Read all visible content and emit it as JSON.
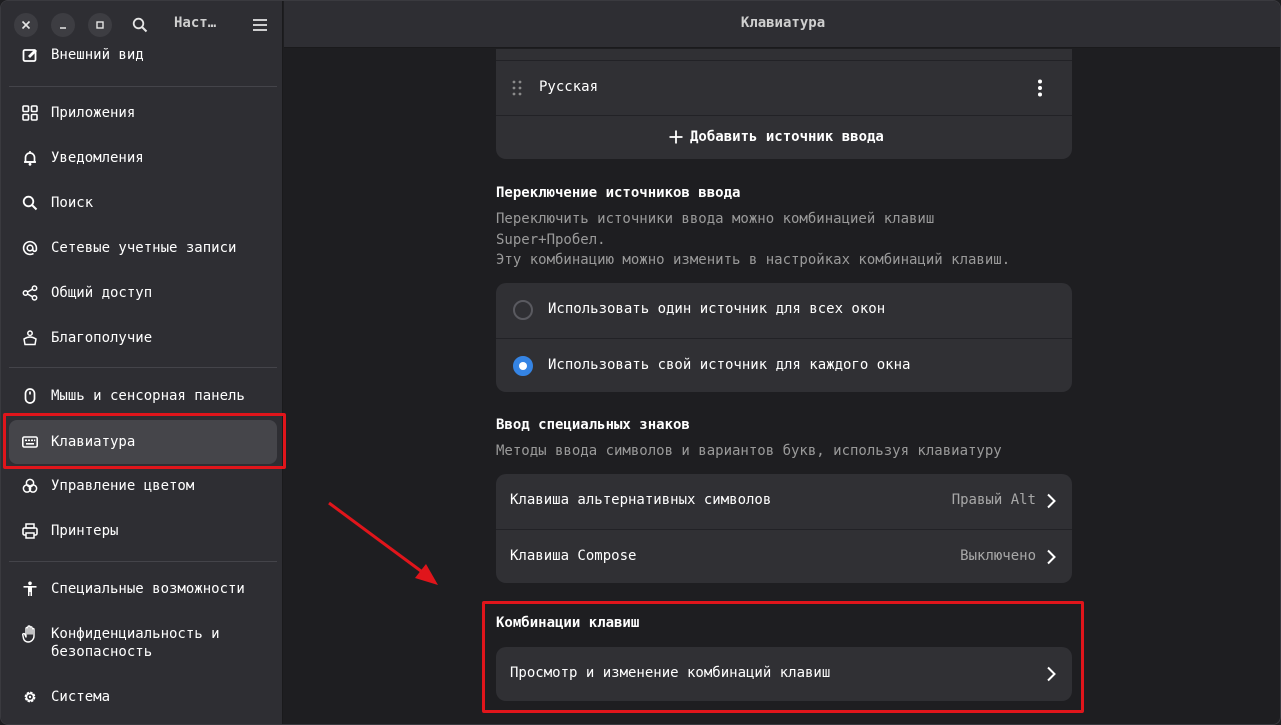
{
  "sidebar": {
    "title": "Наст…",
    "items": [
      {
        "label": "Внешний вид",
        "icon": "appearance-icon"
      },
      {
        "label": "Приложения",
        "icon": "apps-icon"
      },
      {
        "label": "Уведомления",
        "icon": "bell-icon"
      },
      {
        "label": "Поиск",
        "icon": "search-icon"
      },
      {
        "label": "Сетевые учетные записи",
        "icon": "at-icon"
      },
      {
        "label": "Общий доступ",
        "icon": "share-icon"
      },
      {
        "label": "Благополучие",
        "icon": "wellbeing-icon"
      },
      {
        "label": "Мышь и сенсорная панель",
        "icon": "mouse-icon"
      },
      {
        "label": "Клавиатура",
        "icon": "keyboard-icon"
      },
      {
        "label": "Управление цветом",
        "icon": "color-icon"
      },
      {
        "label": "Принтеры",
        "icon": "printer-icon"
      },
      {
        "label": "Специальные возможности",
        "icon": "accessibility-icon"
      },
      {
        "label": "Конфиденциальность и безопасность",
        "label_line1": "Конфиденциальность и",
        "label_line2": "безопасность",
        "icon": "hand-icon"
      },
      {
        "label": "Система",
        "icon": "gear-icon"
      }
    ]
  },
  "main": {
    "title": "Клавиатура",
    "input_sources": {
      "source_name": "Русская",
      "add_label": "Добавить источник ввода"
    },
    "switching": {
      "title": "Переключение источников ввода",
      "desc_line1": "Переключить источники ввода можно комбинацией клавиш",
      "desc_line2": "Super+Пробел.",
      "desc_line3": "Эту комбинацию можно изменить в настройках комбинаций клавиш.",
      "option1": "Использовать один источник для всех окон",
      "option2": "Использовать свой источник для каждого окна",
      "selected": 2
    },
    "special": {
      "title": "Ввод специальных знаков",
      "desc": "Методы ввода символов и вариантов букв, используя клавиатуру",
      "alt_label": "Клавиша альтернативных символов",
      "alt_value": "Правый Alt",
      "compose_label": "Клавиша Compose",
      "compose_value": "Выключено"
    },
    "shortcuts": {
      "title": "Комбинации клавиш",
      "view_label": "Просмотр и изменение комбинаций клавиш"
    }
  },
  "colors": {
    "accent": "#3584e4",
    "highlight": "#e0151b"
  }
}
